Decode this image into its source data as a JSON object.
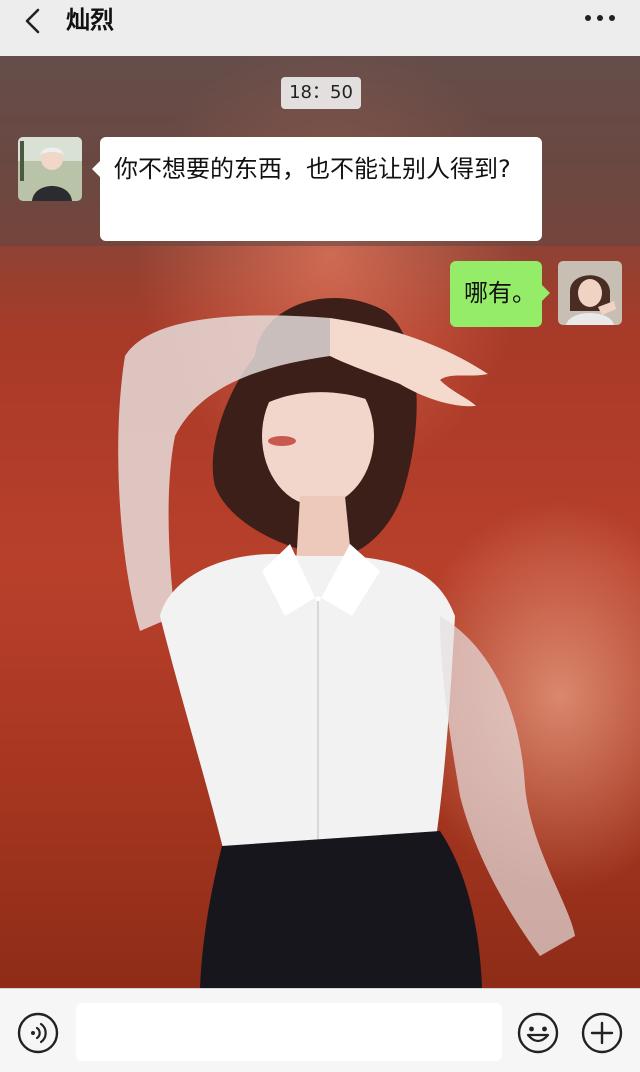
{
  "header": {
    "title": "灿烈",
    "back_icon": "chevron-left-icon",
    "more_icon": "more-dots-icon"
  },
  "chat": {
    "timestamp": "18：50",
    "messages": [
      {
        "side": "left",
        "sender_avatar": "contact-avatar",
        "text": "你不想要的东西，也不能让别人得到?"
      },
      {
        "side": "right",
        "sender_avatar": "self-avatar",
        "text": "哪有。"
      }
    ],
    "bubble_colors": {
      "received": "#ffffff",
      "sent": "#95ec69"
    },
    "wallpaper": "photo of woman in white shirt against red wall"
  },
  "input_bar": {
    "voice_icon": "voice-icon",
    "input_value": "",
    "emoji_icon": "emoji-icon",
    "plus_icon": "plus-icon"
  }
}
